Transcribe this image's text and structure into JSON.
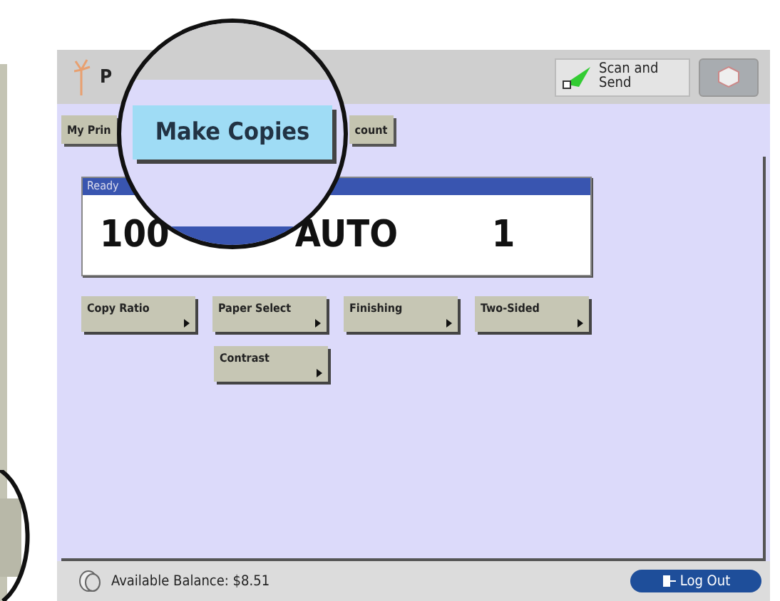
{
  "header": {
    "title": "P",
    "scan_button": "Scan and Send"
  },
  "tabs": [
    {
      "label": "My Prin",
      "selected": false
    },
    {
      "label": "count",
      "selected": false
    }
  ],
  "magnifier": {
    "tab": {
      "label": "Make Copies",
      "selected": true
    }
  },
  "display": {
    "status": "Ready",
    "ratio": "100",
    "paper": "AUTO",
    "copies": "1"
  },
  "function_buttons": [
    [
      {
        "label": "Copy Ratio"
      },
      {
        "label": "Paper Select"
      },
      {
        "label": "Finishing"
      },
      {
        "label": "Two-Sided"
      }
    ],
    [
      {
        "label": "Contrast"
      }
    ]
  ],
  "footer": {
    "balance": "Available Balance: $8.51",
    "logout": "Log Out"
  }
}
